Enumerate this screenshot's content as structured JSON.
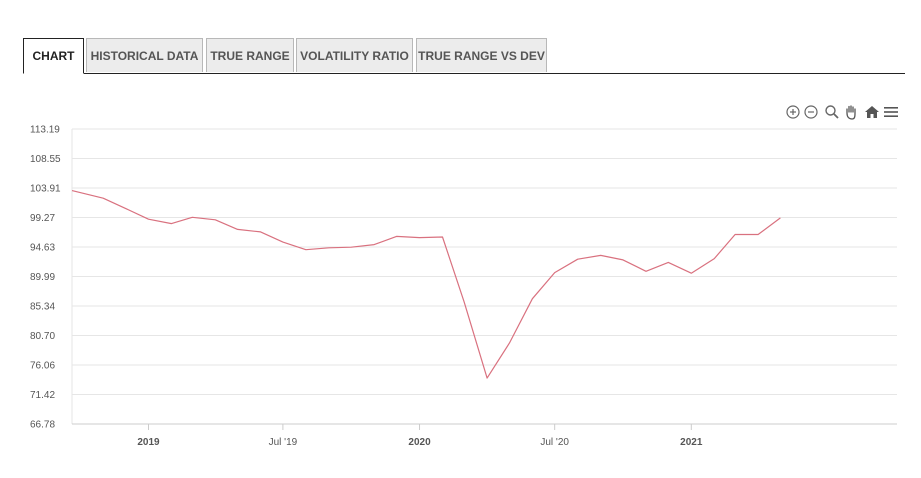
{
  "tabs": [
    {
      "label": "CHART",
      "active": true
    },
    {
      "label": "HISTORICAL DATA",
      "active": false
    },
    {
      "label": "TRUE RANGE",
      "active": false
    },
    {
      "label": "VOLATILITY RATIO",
      "active": false
    },
    {
      "label": "TRUE RANGE VS DEV",
      "active": false
    }
  ],
  "toolbar": {
    "icons": [
      "zoom-in-icon",
      "zoom-out-icon",
      "magnifier-icon",
      "pan-hand-icon",
      "home-icon",
      "menu-icon"
    ]
  },
  "colors": {
    "line": "#d9717f",
    "grid": "#e6e6e6",
    "axis": "#cccccc",
    "tab_border": "#222222"
  },
  "chart_data": {
    "type": "line",
    "title": "",
    "xlabel": "",
    "ylabel": "",
    "grid": true,
    "ylim": [
      66.78,
      113.19
    ],
    "yticks": [
      "113.19",
      "108.55",
      "103.91",
      "99.27",
      "94.63",
      "89.99",
      "85.34",
      "80.70",
      "76.06",
      "71.42",
      "66.78"
    ],
    "xlim": [
      "2018-09-20",
      "2021-10-05"
    ],
    "xticks": [
      {
        "label": "2019",
        "date": "2019-01-01",
        "bold": true
      },
      {
        "label": "Jul '19",
        "date": "2019-07-01",
        "bold": false
      },
      {
        "label": "2020",
        "date": "2020-01-01",
        "bold": true
      },
      {
        "label": "Jul '20",
        "date": "2020-07-01",
        "bold": false
      },
      {
        "label": "2021",
        "date": "2021-01-01",
        "bold": true
      }
    ],
    "series": [
      {
        "x": [
          "2018-09-20",
          "2018-11-01",
          "2018-12-01",
          "2019-01-01",
          "2019-02-01",
          "2019-03-01",
          "2019-04-01",
          "2019-05-01",
          "2019-06-01",
          "2019-07-01",
          "2019-08-01",
          "2019-09-01",
          "2019-10-01",
          "2019-11-01",
          "2019-12-01",
          "2020-01-01",
          "2020-02-01",
          "2020-03-01",
          "2020-04-01",
          "2020-05-01",
          "2020-06-01",
          "2020-07-01",
          "2020-08-01",
          "2020-09-01",
          "2020-10-01",
          "2020-11-01",
          "2020-12-01",
          "2021-01-01",
          "2021-02-01",
          "2021-03-01",
          "2021-04-01",
          "2021-05-01",
          "2021-06-01"
        ],
        "values": [
          103.5,
          102.3,
          100.7,
          99.0,
          98.3,
          99.3,
          98.9,
          97.4,
          97.0,
          95.4,
          94.2,
          94.5,
          94.6,
          95.0,
          96.3,
          96.1,
          96.2,
          86.0,
          74.0,
          79.5,
          86.5,
          90.6,
          92.7,
          93.3,
          92.6,
          90.8,
          92.2,
          90.5,
          92.8,
          96.6,
          96.6,
          99.2,
          null
        ]
      }
    ]
  }
}
